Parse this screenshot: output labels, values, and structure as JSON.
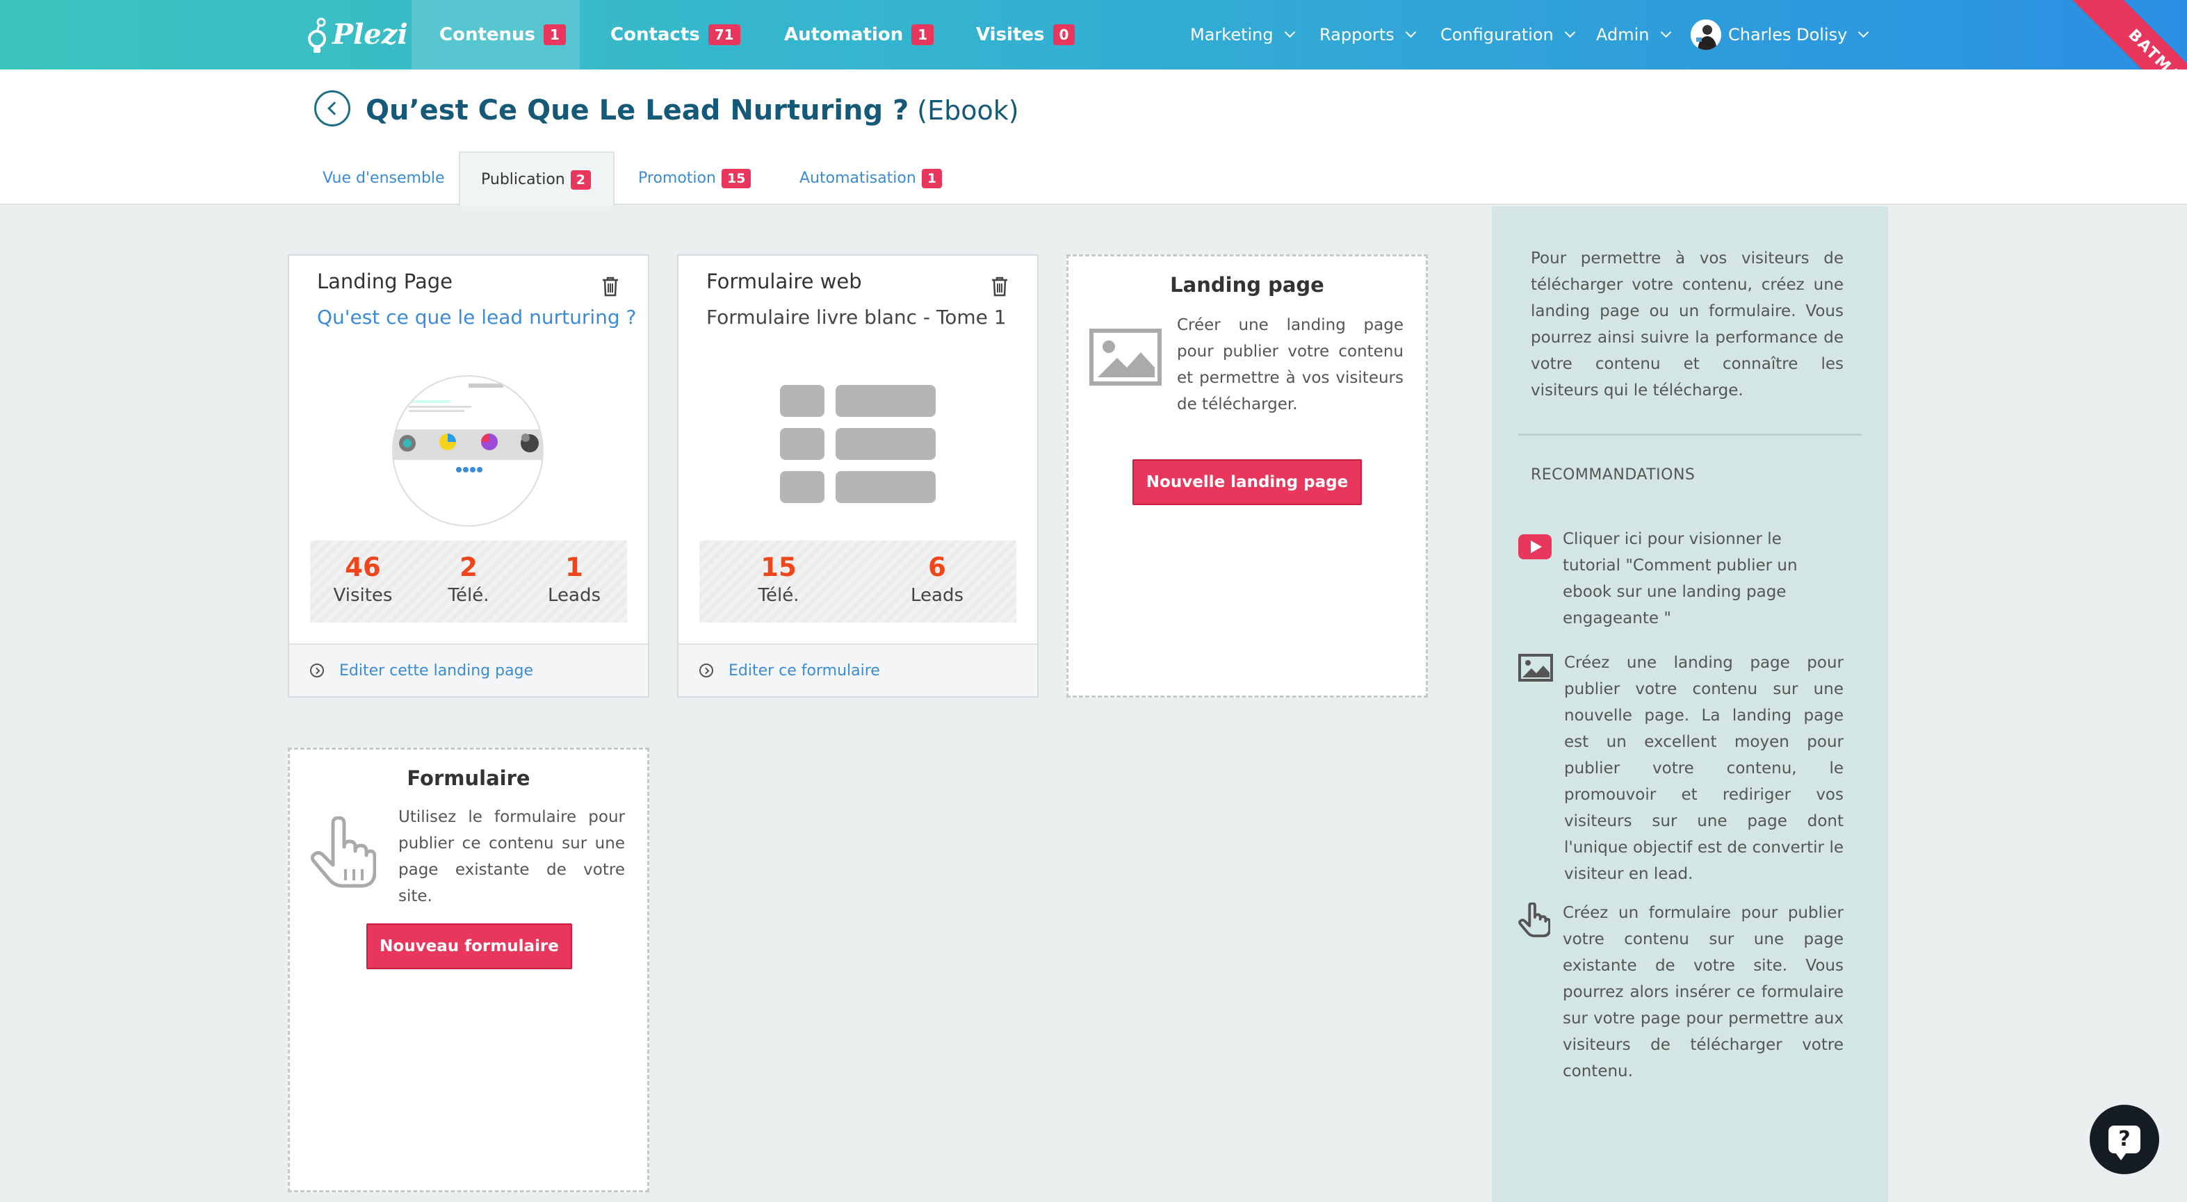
{
  "nav": {
    "logo_text": "Plezi",
    "items": [
      {
        "label": "Contenus",
        "badge": "1"
      },
      {
        "label": "Contacts",
        "badge": "71"
      },
      {
        "label": "Automation",
        "badge": "1"
      },
      {
        "label": "Visites",
        "badge": "0"
      }
    ],
    "menus": [
      "Marketing",
      "Rapports",
      "Configuration",
      "Admin"
    ],
    "user_name": "Charles Dolisy",
    "ribbon": "BATMAN"
  },
  "header": {
    "title": "Qu’est Ce Que Le Lead Nurturing ?",
    "type": "(Ebook)",
    "tabs": [
      {
        "label": "Vue d'ensemble",
        "badge": null
      },
      {
        "label": "Publication",
        "badge": "2"
      },
      {
        "label": "Promotion",
        "badge": "15"
      },
      {
        "label": "Automatisation",
        "badge": "1"
      }
    ]
  },
  "cards": {
    "landing": {
      "title": "Landing Page",
      "link": "Qu'est ce que le lead nurturing ?",
      "stats": [
        {
          "value": "46",
          "label": "Visites"
        },
        {
          "value": "2",
          "label": "Télé."
        },
        {
          "value": "1",
          "label": "Leads"
        }
      ],
      "footer": "Editer cette landing page"
    },
    "form": {
      "title": "Formulaire web",
      "subtitle": "Formulaire livre blanc - Tome 1",
      "stats": [
        {
          "value": "15",
          "label": "Télé."
        },
        {
          "value": "6",
          "label": "Leads"
        }
      ],
      "footer": "Editer ce formulaire"
    },
    "new_landing": {
      "title": "Landing page",
      "desc": "Créer une landing page pour publier votre contenu et permettre à vos visiteurs de télécharger.",
      "button": "Nouvelle landing page"
    },
    "new_form": {
      "title": "Formulaire",
      "desc": "Utilisez le formulaire pour publier ce contenu sur une page existante de votre site.",
      "button": "Nouveau formulaire"
    }
  },
  "sidebar": {
    "intro": "Pour permettre à vos visiteurs de télécharger votre contenu, créez une landing page ou un formulaire. Vous pourrez ainsi suivre la performance de votre contenu et connaître les visiteurs qui le télécharge.",
    "heading": "RECOMMANDATIONS",
    "recs": [
      {
        "icon": "play-icon",
        "text": "Cliquer ici pour visionner le tutorial \"Comment publier un ebook sur une landing page engageante \""
      },
      {
        "icon": "image-icon",
        "text": "Créez une landing page pour publier votre contenu sur une nouvelle page. La landing page est un excellent moyen pour publier votre contenu, le promouvoir et rediriger vos visiteurs sur une page dont l'unique objectif est de convertir le visiteur en lead."
      },
      {
        "icon": "pointer-hand-icon",
        "text": "Créez un formulaire pour publier votre contenu sur une page existante de votre site. Vous pourrez alors insérer ce formulaire sur votre page pour permettre aux visiteurs de télécharger votre contenu."
      }
    ]
  },
  "help": {
    "label": "?"
  },
  "colors": {
    "accent": "#e8365d",
    "stat": "#f0461b",
    "link": "#3b8bd5",
    "title": "#145a78"
  }
}
